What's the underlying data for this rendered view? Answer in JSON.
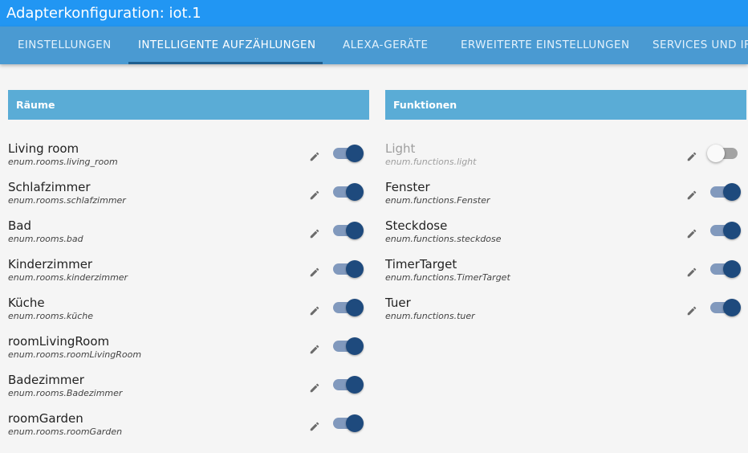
{
  "window": {
    "title": "Adapterkonfiguration: iot.1"
  },
  "tabs": [
    {
      "label": "EINSTELLUNGEN",
      "active": false
    },
    {
      "label": "INTELLIGENTE AUFZÄHLUNGEN",
      "active": true
    },
    {
      "label": "ALEXA-GERÄTE",
      "active": false
    },
    {
      "label": "ERWEITERTE EINSTELLUNGEN",
      "active": false
    },
    {
      "label": "SERVICES UND IF",
      "active": false
    }
  ],
  "rooms": {
    "header": "Räume",
    "items": [
      {
        "name": "Living room",
        "id": "enum.rooms.living_room",
        "enabled": true
      },
      {
        "name": "Schlafzimmer",
        "id": "enum.rooms.schlafzimmer",
        "enabled": true
      },
      {
        "name": "Bad",
        "id": "enum.rooms.bad",
        "enabled": true
      },
      {
        "name": "Kinderzimmer",
        "id": "enum.rooms.kinderzimmer",
        "enabled": true
      },
      {
        "name": "Küche",
        "id": "enum.rooms.küche",
        "enabled": true
      },
      {
        "name": "roomLivingRoom",
        "id": "enum.rooms.roomLivingRoom",
        "enabled": true
      },
      {
        "name": "Badezimmer",
        "id": "enum.rooms.Badezimmer",
        "enabled": true
      },
      {
        "name": "roomGarden",
        "id": "enum.rooms.roomGarden",
        "enabled": true
      }
    ]
  },
  "functions": {
    "header": "Funktionen",
    "items": [
      {
        "name": "Light",
        "id": "enum.functions.light",
        "enabled": false
      },
      {
        "name": "Fenster",
        "id": "enum.functions.Fenster",
        "enabled": true
      },
      {
        "name": "Steckdose",
        "id": "enum.functions.steckdose",
        "enabled": true
      },
      {
        "name": "TimerTarget",
        "id": "enum.functions.TimerTarget",
        "enabled": true
      },
      {
        "name": "Tuer",
        "id": "enum.functions.tuer",
        "enabled": true
      }
    ]
  },
  "colors": {
    "title_bar": "#2196f3",
    "tab_bar": "#4a9ad2",
    "panel_header": "#5aacd6",
    "toggle_on": "#1e4a7d",
    "toggle_track_on": "#8199bd"
  },
  "icons": {
    "edit": "pencil-icon"
  }
}
